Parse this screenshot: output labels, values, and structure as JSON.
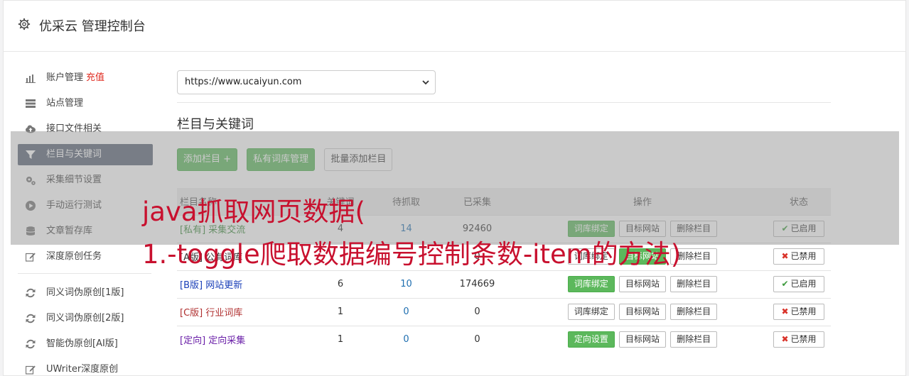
{
  "app": {
    "title": "优采云 管理控制台"
  },
  "sidebar": {
    "items": [
      {
        "label": "账户管理",
        "badge": "充值",
        "icon": "bar-chart-icon"
      },
      {
        "label": "站点管理",
        "icon": "server-icon"
      },
      {
        "label": "接口文件相关",
        "icon": "cloud-upload-icon"
      },
      {
        "label": "栏目与关键词",
        "icon": "filter-icon",
        "active": true
      },
      {
        "label": "采集细节设置",
        "icon": "gears-icon"
      },
      {
        "label": "手动运行测试",
        "icon": "play-icon"
      },
      {
        "label": "文章暂存库",
        "icon": "database-icon"
      },
      {
        "label": "深度原创任务",
        "icon": "edit-icon"
      }
    ],
    "items2": [
      {
        "label": "同义词伪原创[1版]",
        "icon": "refresh-icon"
      },
      {
        "label": "同义词伪原创[2版]",
        "icon": "refresh-icon"
      },
      {
        "label": "智能伪原创[AI版]",
        "icon": "refresh-icon"
      },
      {
        "label": "UWriter深度原创",
        "icon": "edit-icon"
      }
    ]
  },
  "site_select": {
    "value": "https://www.ucaiyun.com"
  },
  "section": {
    "title": "栏目与关键词"
  },
  "toolbar": {
    "add_column": "添加栏目 +",
    "private_lib": "私有词库管理",
    "batch_add": "批量添加栏目"
  },
  "table": {
    "headers": [
      "栏目名称",
      "关键词",
      "待抓取",
      "已采集",
      "操作",
      "状态"
    ],
    "rows": [
      {
        "category": "[私有] 采集交流",
        "c1": "4",
        "c2": "14",
        "c3": "92460",
        "op1": "词库绑定",
        "op1_green": true,
        "op2": "目标网站",
        "op3": "删除栏目",
        "status": "已启用",
        "status_on": true,
        "color": "cat-green"
      },
      {
        "category": "[A版] 公有词库",
        "c1": "",
        "c2": "",
        "c3": "0",
        "op1": "词库绑定",
        "op1_green": false,
        "op2": "目标网站",
        "op3": "删除栏目",
        "status": "已禁用",
        "status_on": false,
        "color": "cat-black"
      },
      {
        "category": "[B版] 网站更新",
        "c1": "6",
        "c2": "10",
        "c3": "174669",
        "op1": "词库绑定",
        "op1_green": true,
        "op2": "目标网站",
        "op3": "删除栏目",
        "status": "已启用",
        "status_on": true,
        "color": "cat-blue"
      },
      {
        "category": "[C版] 行业词库",
        "c1": "1",
        "c2": "0",
        "c3": "0",
        "op1": "词库绑定",
        "op1_green": false,
        "op2": "目标网站",
        "op3": "删除栏目",
        "status": "已禁用",
        "status_on": false,
        "color": "cat-red"
      },
      {
        "category": "[定向] 定向采集",
        "c1": "1",
        "c2": "0",
        "c3": "0",
        "op1": "定向设置",
        "op1_green": true,
        "op2": "目标网站",
        "op3": "删除栏目",
        "status": "已禁用",
        "status_on": false,
        "color": "cat-purple"
      }
    ]
  },
  "overlay": {
    "line1": "java抓取网页数据(",
    "line2": "1.-toggle爬取数据编号控制条数-item的方法)"
  },
  "colors": {
    "accent": "#5cb85c",
    "sidebar_active": "#5a6577",
    "overlay_text": "#c8102e"
  }
}
